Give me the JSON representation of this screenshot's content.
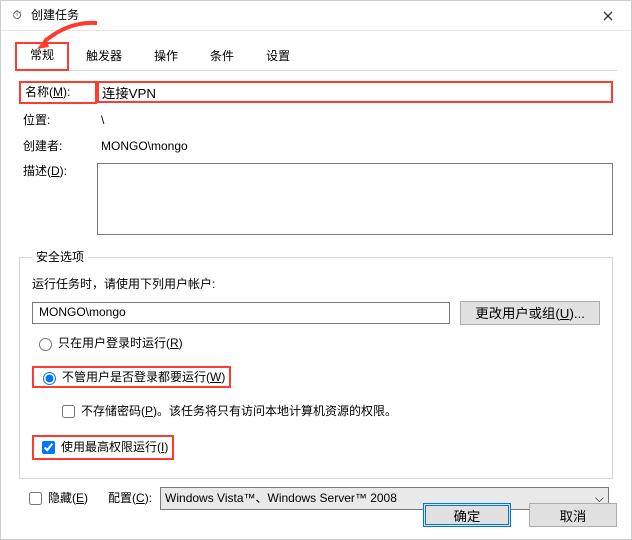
{
  "window": {
    "title": "创建任务"
  },
  "tabs": {
    "general": "常规",
    "triggers": "触发器",
    "actions": "操作",
    "conditions": "条件",
    "settings": "设置"
  },
  "general": {
    "name_label": "名称(M):",
    "name_value": "连接VPN",
    "location_label": "位置:",
    "location_value": "\\",
    "creator_label": "创建者:",
    "creator_value": "MONGO\\mongo",
    "description_label": "描述(D):",
    "description_value": ""
  },
  "security": {
    "legend": "安全选项",
    "runas_hint": "运行任务时，请使用下列用户帐户:",
    "runas_user": "MONGO\\mongo",
    "change_user_btn": "更改用户或组(U)...",
    "opt_logged_on": "只在用户登录时运行(R)",
    "opt_any": "不管用户是否登录都要运行(W)",
    "opt_nopwd": "不存储密码(P)。该任务将只有访问本地计算机资源的权限。",
    "opt_highest": "使用最高权限运行(I)"
  },
  "config": {
    "hidden_label": "隐藏(E)",
    "configure_label": "配置(C):",
    "configure_value": "Windows Vista™、Windows Server™ 2008"
  },
  "footer": {
    "ok": "确定",
    "cancel": "取消"
  },
  "icons": {
    "app": "⏱"
  }
}
